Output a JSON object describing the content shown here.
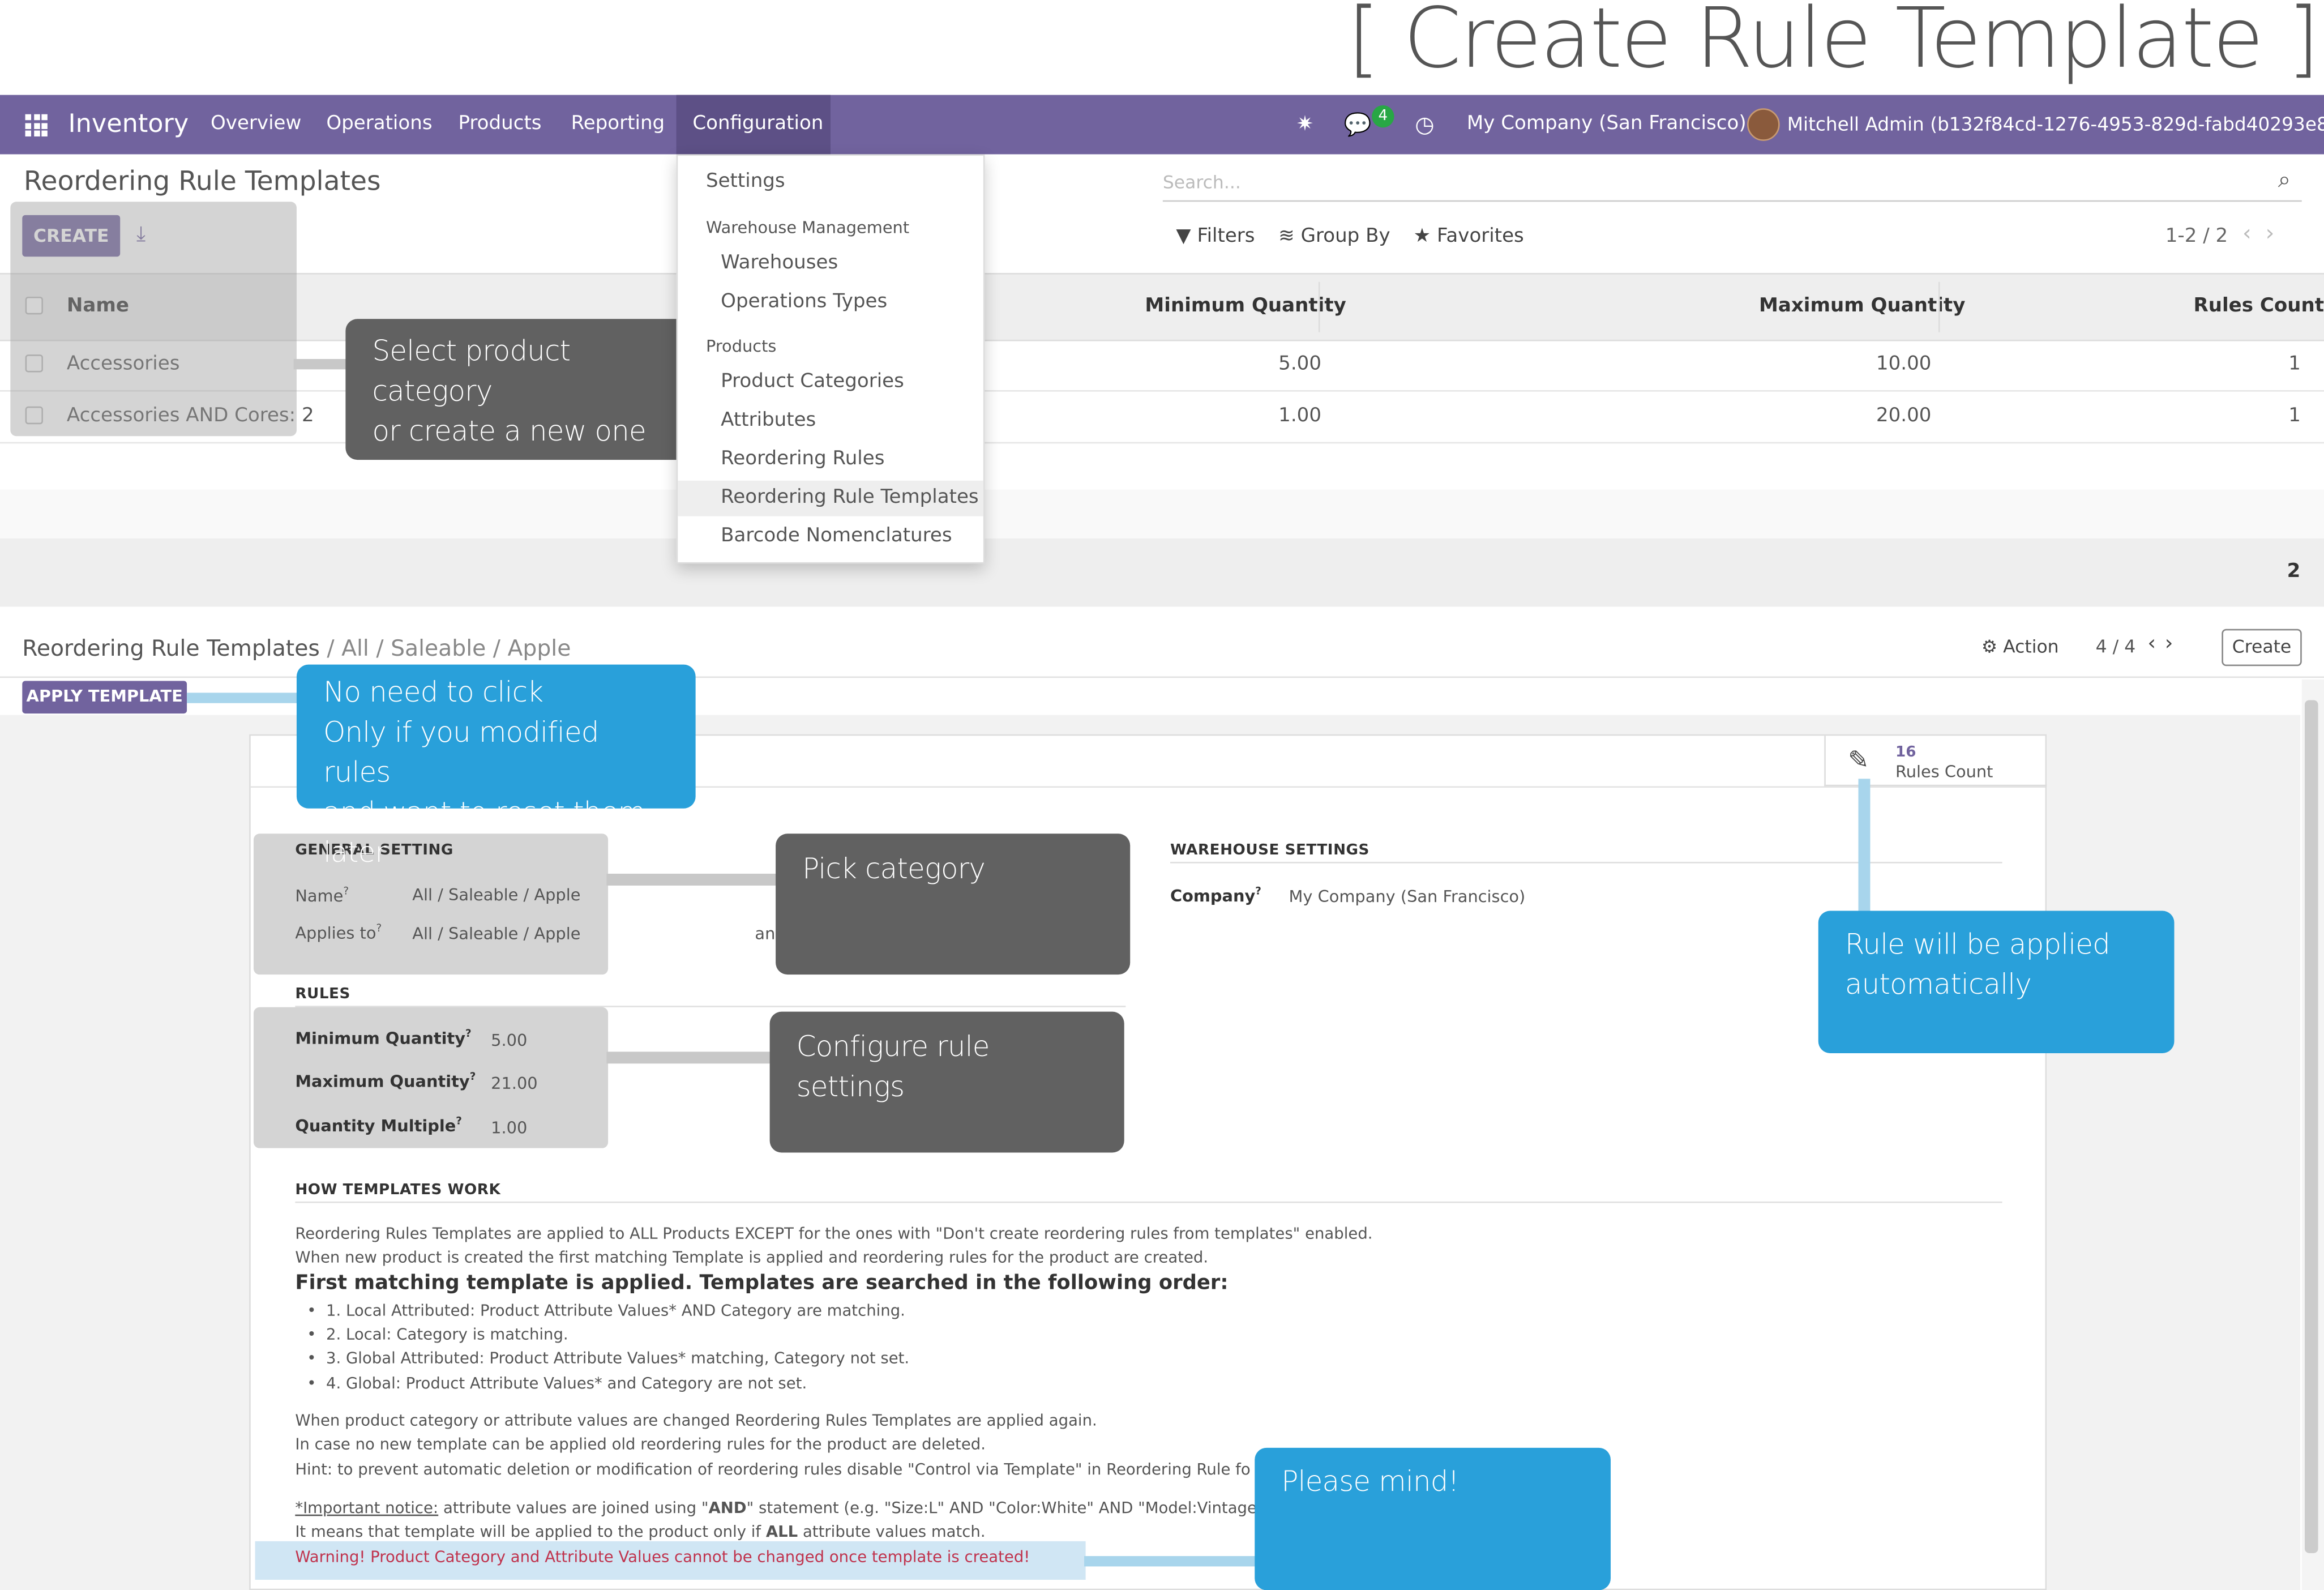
{
  "page_title": "[ Create Rule Template ]",
  "navbar": {
    "app_name": "Inventory",
    "menus": [
      "Overview",
      "Operations",
      "Products",
      "Reporting",
      "Configuration"
    ],
    "message_count": "4",
    "company": "My Company (San Francisco)",
    "user": "Mitchell Admin (b132f84cd-1276-4953-829d-fabd40293e8e)"
  },
  "list_view": {
    "title": "Reordering Rule Templates",
    "create_label": "CREATE",
    "search_placeholder": "Search...",
    "filters_label": "Filters",
    "group_by_label": "Group By",
    "favorites_label": "Favorites",
    "pager": "1-2 / 2",
    "columns": [
      "Name",
      "Minimum Quantity",
      "Maximum Quantity",
      "Rules Count"
    ],
    "rows": [
      {
        "name": "Accessories",
        "min": "5.00",
        "max": "10.00",
        "count": "1"
      },
      {
        "name": "Accessories AND Cores: 2",
        "min": "1.00",
        "max": "20.00",
        "count": "1"
      }
    ],
    "total_count": "2"
  },
  "config_menu": {
    "settings": "Settings",
    "warehouse_header": "Warehouse Management",
    "warehouses": "Warehouses",
    "operations_types": "Operations Types",
    "products_header": "Products",
    "product_categories": "Product Categories",
    "attributes": "Attributes",
    "reordering_rules": "Reordering Rules",
    "reordering_rule_templates": "Reordering Rule Templates",
    "barcode_nomenclatures": "Barcode Nomenclatures"
  },
  "form_view": {
    "breadcrumb_root": "Reordering Rule Templates",
    "breadcrumb_current": "/ All / Saleable / Apple",
    "apply_template_label": "APPLY TEMPLATE",
    "action_label": "Action",
    "pager": "4 / 4",
    "create_label": "Create",
    "rules_count_value": "16",
    "rules_count_label": "Rules Count",
    "general_setting_title": "GENERAL SETTING",
    "name_label": "Name",
    "name_value": "All / Saleable / Apple",
    "applies_to_label": "Applies to",
    "applies_to_value": "All / Saleable / Apple",
    "applies_to_suffix": "an",
    "warehouse_settings_title": "WAREHOUSE SETTINGS",
    "company_label": "Company",
    "company_value": "My Company (San Francisco)",
    "rules_title": "RULES",
    "min_qty_label": "Minimum Quantity",
    "min_qty_value": "5.00",
    "max_qty_label": "Maximum Quantity",
    "max_qty_value": "21.00",
    "qty_multiple_label": "Quantity Multiple",
    "qty_multiple_value": "1.00",
    "how_title": "HOW TEMPLATES WORK",
    "how_p1": "Reordering Rules Templates are applied to ALL Products EXCEPT for the ones with \"Don't create reordering rules from templates\" enabled.",
    "how_p2": "When new product is created the first matching Template is applied and reordering rules for the product are created.",
    "how_strong": "First matching template is applied. Templates are searched in the following order:",
    "how_list": [
      "1. Local Attributed: Product Attribute Values* AND Category are matching.",
      "2. Local: Category is matching.",
      "3. Global Attributed: Product Attribute Values* matching, Category not set.",
      "4. Global: Product Attribute Values* and Category are not set."
    ],
    "how_p3": "When product category or attribute values are changed Reordering Rules Templates are applied again.",
    "how_p4": "In case no new template can be applied old reordering rules for the product are deleted.",
    "how_p5": "Hint: to prevent automatic deletion or modification of reordering rules disable \"Control via Template\" in Reordering Rule fo",
    "notice_label": "*Important notice:",
    "notice_text_a": " attribute values are joined using \"",
    "notice_and": "AND",
    "notice_text_b": "\" statement (e.g. \"Size:L\" AND \"Color:White\" AND \"Model:Vintage",
    "notice_p2_a": "It means that template will be applied to the product only if ",
    "notice_all": "ALL",
    "notice_p2_b": " attribute values match.",
    "warning": "Warning! Product Category and Attribute Values cannot be changed once template is created!"
  },
  "callouts": {
    "select_category": "Select product category\nor create a new one",
    "no_need": "No need to click\nOnly if you modified rules\nand want to reset them later",
    "pick_category": "Pick category",
    "configure_rules": "Configure rule settings",
    "applied_auto": "Rule will be applied\nautomatically",
    "please_mind": "Please mind!"
  },
  "colors": {
    "brand": "#71639e",
    "callout_dark": "#616161",
    "callout_blue": "#29a0da",
    "warning": "#c0334d",
    "badge": "#28a745"
  }
}
